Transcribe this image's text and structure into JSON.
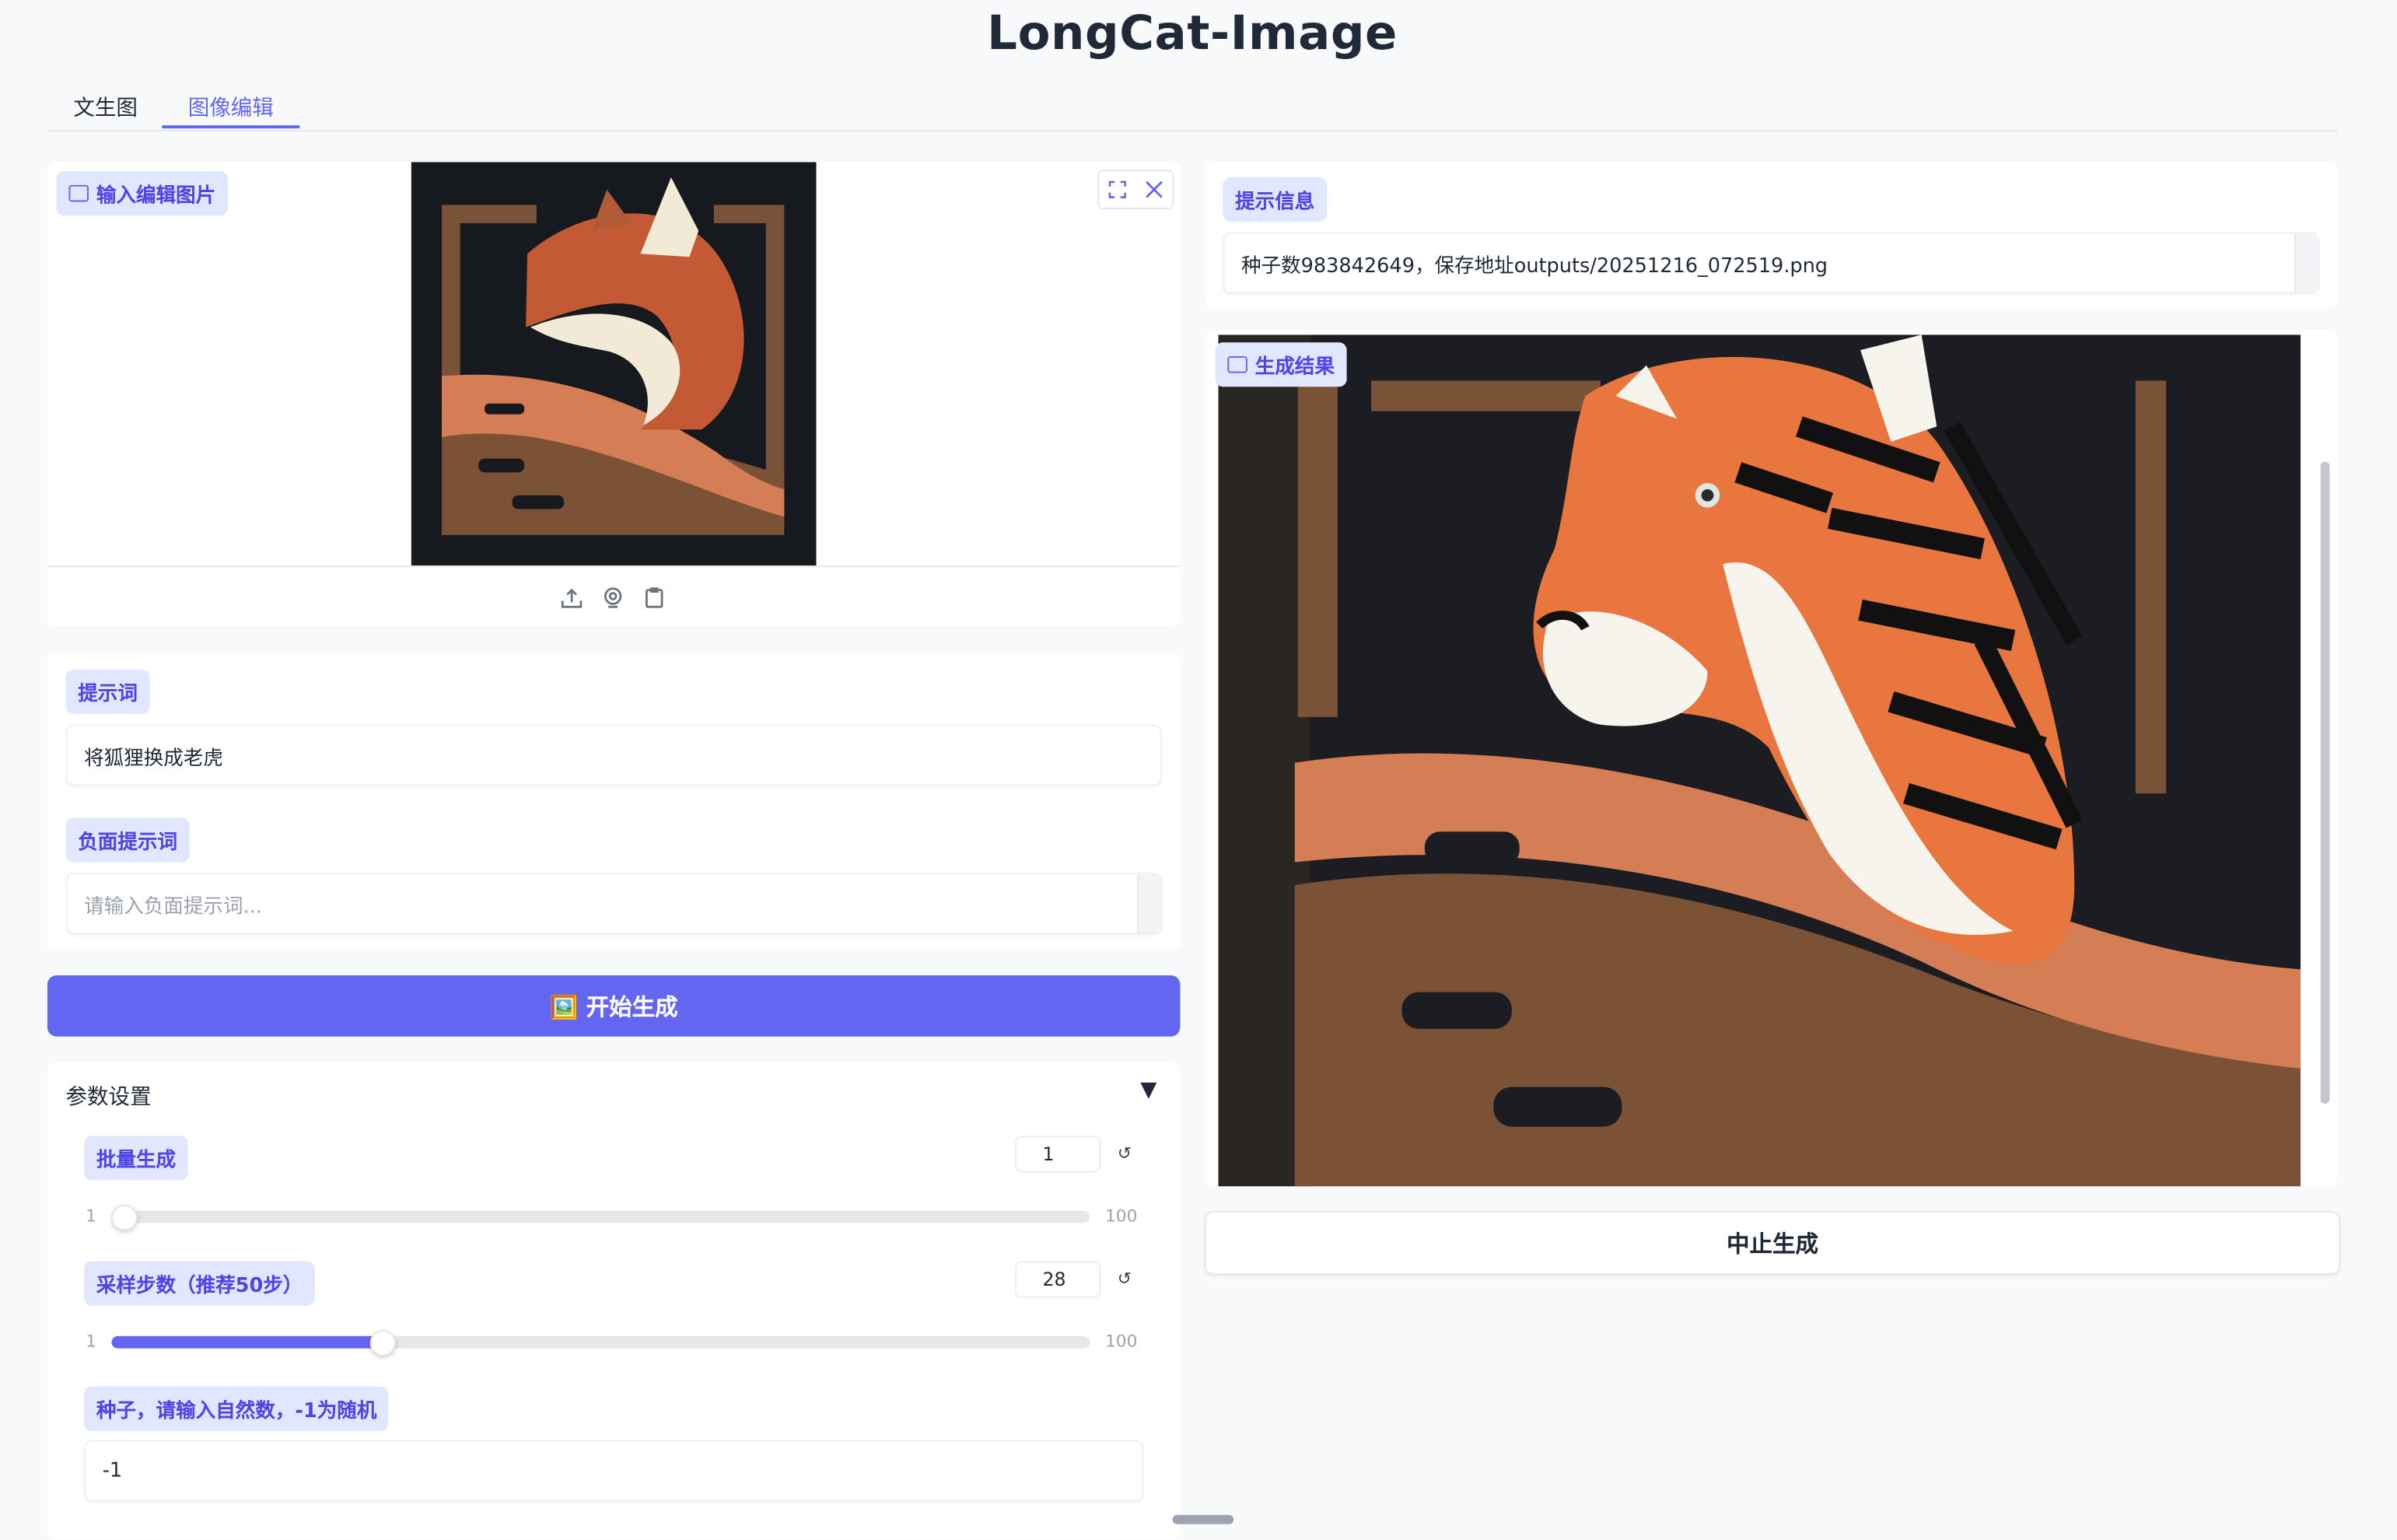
{
  "app": {
    "title": "LongCat-Image"
  },
  "tabs": [
    {
      "label": "文生图",
      "active": false
    },
    {
      "label": "图像编辑",
      "active": true
    }
  ],
  "input_image": {
    "label": "输入编辑图片"
  },
  "prompt": {
    "label": "提示词",
    "value": "将狐狸换成老虎"
  },
  "negative_prompt": {
    "label": "负面提示词",
    "placeholder": "请输入负面提示词..."
  },
  "generate_button": {
    "label": "🖼️ 开始生成"
  },
  "params": {
    "title": "参数设置",
    "collapse_glyph": "▼",
    "batch": {
      "label": "批量生成",
      "value": "1",
      "min": "1",
      "max": "100"
    },
    "steps": {
      "label": "采样步数（推荐50步）",
      "value": "28",
      "min": "1",
      "max": "100"
    },
    "seed": {
      "label": "种子，请输入自然数，-1为随机",
      "value": "-1"
    }
  },
  "info": {
    "label": "提示信息",
    "value": "种子数983842649，保存地址outputs/20251216_072519.png"
  },
  "result": {
    "label": "生成结果"
  },
  "stop_button": {
    "label": "中止生成"
  },
  "icons": {
    "reset": "↺",
    "upload": "upload-icon",
    "webcam": "webcam-icon",
    "clipboard": "clipboard-icon",
    "fullscreen": "fullscreen-icon",
    "close": "close-icon"
  },
  "colors": {
    "accent": "#6366f1",
    "label_bg": "#e0e7ff"
  }
}
